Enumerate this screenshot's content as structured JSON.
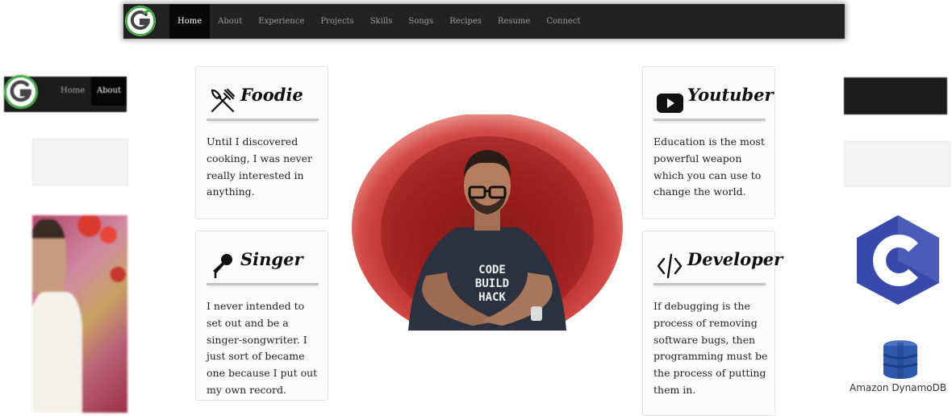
{
  "nav": {
    "links": [
      "Home",
      "About",
      "Experience",
      "Projects",
      "Skills",
      "Songs",
      "Recipes",
      "Resume",
      "Connect"
    ],
    "active": "Home"
  },
  "left_preview": {
    "home": "Home",
    "about": "About"
  },
  "cards": {
    "foodie": {
      "title": "Foodie",
      "icon": "fork-knife-icon",
      "text": "Until I discovered cooking, I was never really interested in anything."
    },
    "singer": {
      "title": "Singer",
      "icon": "microphone-icon",
      "text": "I never intended to set out and be a singer-songwriter. I just sort of became one because I put out my own record."
    },
    "youtuber": {
      "title": "Youtuber",
      "icon": "youtube-icon",
      "text": "Education is the most powerful weapon which you can use to change the world."
    },
    "developer": {
      "title": "Developer",
      "icon": "code-icon",
      "text": "If debugging is the process of removing software bugs, then programming must be the process of putting them in."
    }
  },
  "hero": {
    "shirt_lines": [
      "CODE",
      "BUILD",
      "HACK"
    ]
  },
  "right_preview": {
    "dynamo_label": "Amazon DynamoDB"
  },
  "colors": {
    "nav_bg": "#222222",
    "nav_active_bg": "#080808",
    "logo_green": "#3aa93c",
    "chair_red": "#c9302c",
    "c_logo_blue": "#3949ab"
  }
}
